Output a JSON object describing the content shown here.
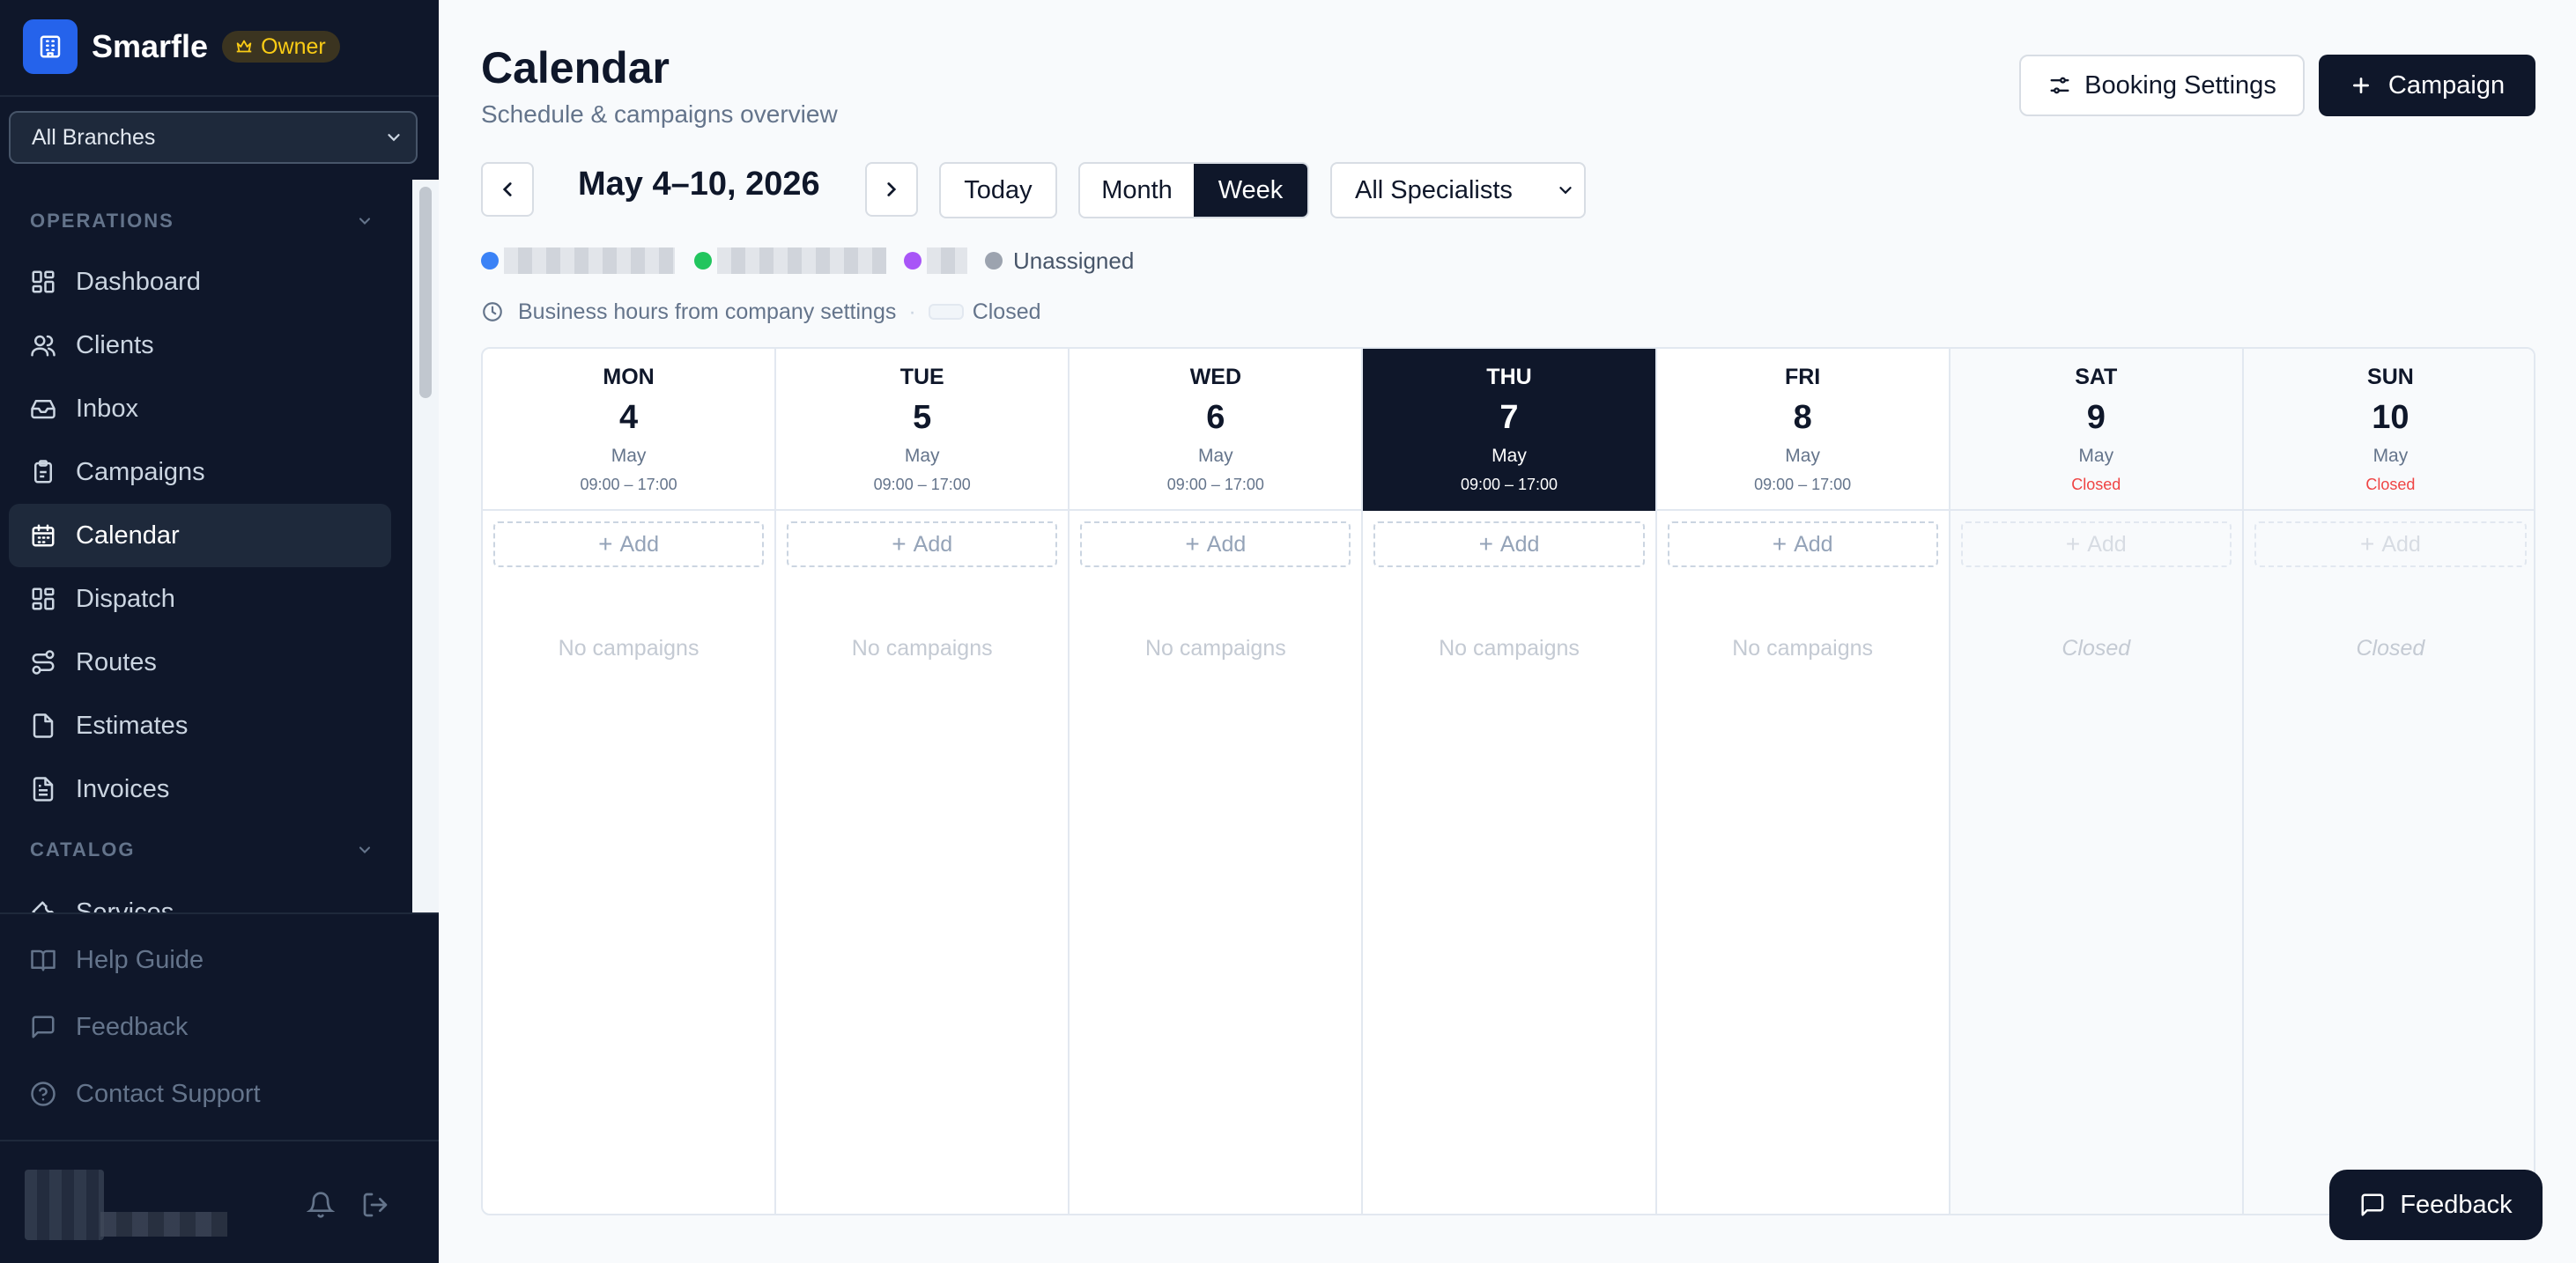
{
  "brand": {
    "name": "Smarfle",
    "badge": "Owner"
  },
  "branch_select": {
    "value": "All Branches"
  },
  "sidebar": {
    "groups": [
      {
        "label": "OPERATIONS"
      },
      {
        "label": "CATALOG"
      }
    ],
    "items": [
      {
        "label": "Dashboard",
        "icon": "grid-icon"
      },
      {
        "label": "Clients",
        "icon": "users-icon"
      },
      {
        "label": "Inbox",
        "icon": "inbox-icon"
      },
      {
        "label": "Campaigns",
        "icon": "clipboard-icon"
      },
      {
        "label": "Calendar",
        "icon": "calendar-icon",
        "active": true
      },
      {
        "label": "Dispatch",
        "icon": "grid-icon"
      },
      {
        "label": "Routes",
        "icon": "route-icon"
      },
      {
        "label": "Estimates",
        "icon": "file-icon"
      },
      {
        "label": "Invoices",
        "icon": "file-text-icon"
      },
      {
        "label": "Services",
        "icon": "wrench-icon"
      }
    ],
    "bottom": [
      {
        "label": "Help Guide",
        "icon": "book-icon"
      },
      {
        "label": "Feedback",
        "icon": "message-icon"
      },
      {
        "label": "Contact Support",
        "icon": "help-circle-icon"
      }
    ]
  },
  "header": {
    "title": "Calendar",
    "subtitle": "Schedule & campaigns overview",
    "booking_settings": "Booking Settings",
    "campaign": "Campaign"
  },
  "toolbar": {
    "range": "May 4–10, 2026",
    "today": "Today",
    "month": "Month",
    "week": "Week",
    "active_view": "Week",
    "specialists": "All Specialists"
  },
  "legend": {
    "colors": [
      "#3b82f6",
      "#22c55e",
      "#a855f7",
      "#9ca3af"
    ],
    "unassigned": "Unassigned"
  },
  "hours_note": {
    "text": "Business hours from company settings",
    "closed_label": "Closed"
  },
  "week": {
    "add_label": "Add",
    "empty_label": "No campaigns",
    "closed_label": "Closed",
    "days": [
      {
        "name": "MON",
        "num": "4",
        "month": "May",
        "hours": "09:00 – 17:00",
        "closed": false,
        "today": false
      },
      {
        "name": "TUE",
        "num": "5",
        "month": "May",
        "hours": "09:00 – 17:00",
        "closed": false,
        "today": false
      },
      {
        "name": "WED",
        "num": "6",
        "month": "May",
        "hours": "09:00 – 17:00",
        "closed": false,
        "today": false
      },
      {
        "name": "THU",
        "num": "7",
        "month": "May",
        "hours": "09:00 – 17:00",
        "closed": false,
        "today": true
      },
      {
        "name": "FRI",
        "num": "8",
        "month": "May",
        "hours": "09:00 – 17:00",
        "closed": false,
        "today": false
      },
      {
        "name": "SAT",
        "num": "9",
        "month": "May",
        "hours": "Closed",
        "closed": true,
        "today": false
      },
      {
        "name": "SUN",
        "num": "10",
        "month": "May",
        "hours": "Closed",
        "closed": true,
        "today": false
      }
    ]
  },
  "feedback_button": "Feedback",
  "colors": {
    "sidebar_bg": "#0f172a",
    "accent": "#2563eb",
    "owner_badge": "#facc15",
    "closed_red": "#ef4444"
  }
}
